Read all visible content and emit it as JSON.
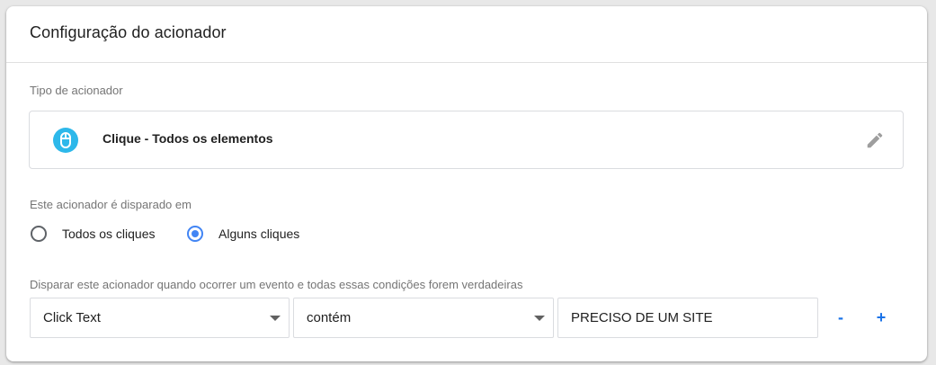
{
  "panel": {
    "title": "Configuração do acionador"
  },
  "trigger_type": {
    "label": "Tipo de acionador",
    "name": "Clique - Todos os elementos",
    "icon": "mouse-icon",
    "icon_color": "#2db8ea"
  },
  "fires_on": {
    "label": "Este acionador é disparado em",
    "options": [
      {
        "label": "Todos os cliques",
        "selected": false
      },
      {
        "label": "Alguns cliques",
        "selected": true
      }
    ],
    "accent": "#4285f4"
  },
  "conditions": {
    "label": "Disparar este acionador quando ocorrer um evento e todas essas condições forem verdadeiras",
    "rows": [
      {
        "variable": "Click Text",
        "operator": "contém",
        "value": "PRECISO DE UM SITE",
        "remove_label": "-",
        "add_label": "+"
      }
    ]
  }
}
